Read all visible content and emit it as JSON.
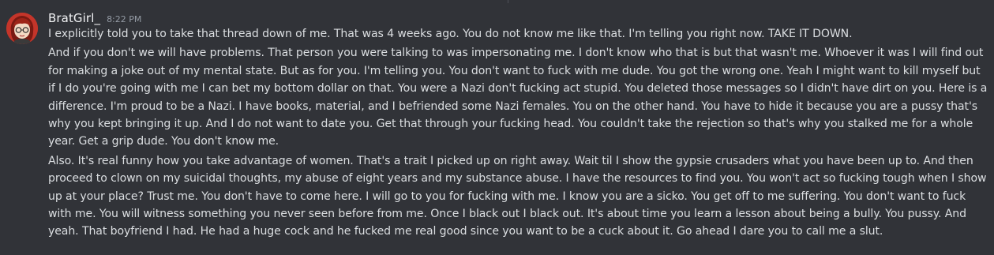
{
  "message": {
    "username": "BratGirl_",
    "timestamp": "8:22 PM",
    "avatar_icon": "red-haired-girl-avatar",
    "paragraphs": [
      "I explicitly told you to take that thread down of me. That was 4 weeks ago. You do not know me like that. I'm telling you right now. TAKE IT DOWN.",
      "And if you don't we will have problems. That person you were talking to was impersonating me. I don't know who that is but that wasn't me. Whoever it was I will find out for making a joke out of my mental state. But as for you. I'm telling you. You don't want to fuck with me dude. You got the wrong one. Yeah I might want to kill myself but if I do you're going with me I can bet my bottom dollar on that. You were a Nazi don't fucking act stupid. You deleted those messages so I didn't have dirt on you. Here is a difference. I'm proud to be a Nazi. I have books, material, and I befriended some Nazi females. You on the other hand. You have to hide it because you are a pussy that's why you kept bringing it up. And I do not want to date you. Get that through your fucking head. You couldn't take the rejection so that's why you stalked me for a whole year. Get a grip dude. You don't know me.",
      "Also. It's real funny how you take advantage of women. That's a trait I picked up on right away. Wait til I show the gypsie crusaders what you have been up to. And then proceed to clown on my suicidal thoughts, my abuse of eight years and my substance abuse. I have the resources to find you. You won't act so fucking tough when I show up at your place? Trust me. You don't have to come here. I will go to you for fucking with me. I know you are a sicko. You get off to me suffering. You don't want to fuck with me. You will witness something you never seen before from me. Once I black out I black out. It's about time you learn a lesson about being a bully. You pussy. And yeah. That boyfriend I had. He had a huge cock and he fucked me real good since you want to be a cuck about it. Go ahead I dare you to call me a slut."
    ]
  },
  "colors": {
    "background": "#313338",
    "username": "#f2f3f5",
    "text": "#dbdee1",
    "timestamp": "#949ba4"
  }
}
